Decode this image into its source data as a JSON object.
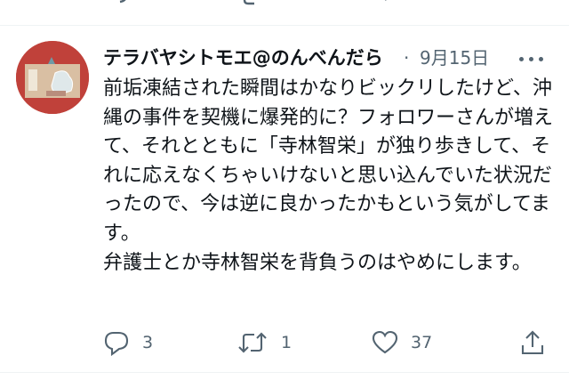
{
  "tweet": {
    "display_name": "テラバヤシトモエ@のんべんだら",
    "separator": "·",
    "date": "9月15日",
    "text": "前垢凍結された瞬間はかなりビックリしたけど、沖縄の事件を契機に爆発的に？フォロワーさんが増えて、それとともに「寺林智栄」が独り歩きして、それに応えなくちゃいけないと思い込んでいた状況だったので、今は逆に良かったかもという気がしてます。\n弁護士とか寺林智栄を背負うのはやめにします。",
    "reply_count": "3",
    "retweet_count": "1",
    "like_count": "37"
  },
  "icons": {
    "more": "more-horizontal-icon",
    "reply": "reply-bubble-icon",
    "retweet": "retweet-arrows-icon",
    "like": "heart-icon",
    "share": "share-upload-icon"
  },
  "colors": {
    "text_primary": "#0f1419",
    "text_secondary": "#536471",
    "divider": "#eff3f4",
    "avatar_background": "#c0413a"
  }
}
